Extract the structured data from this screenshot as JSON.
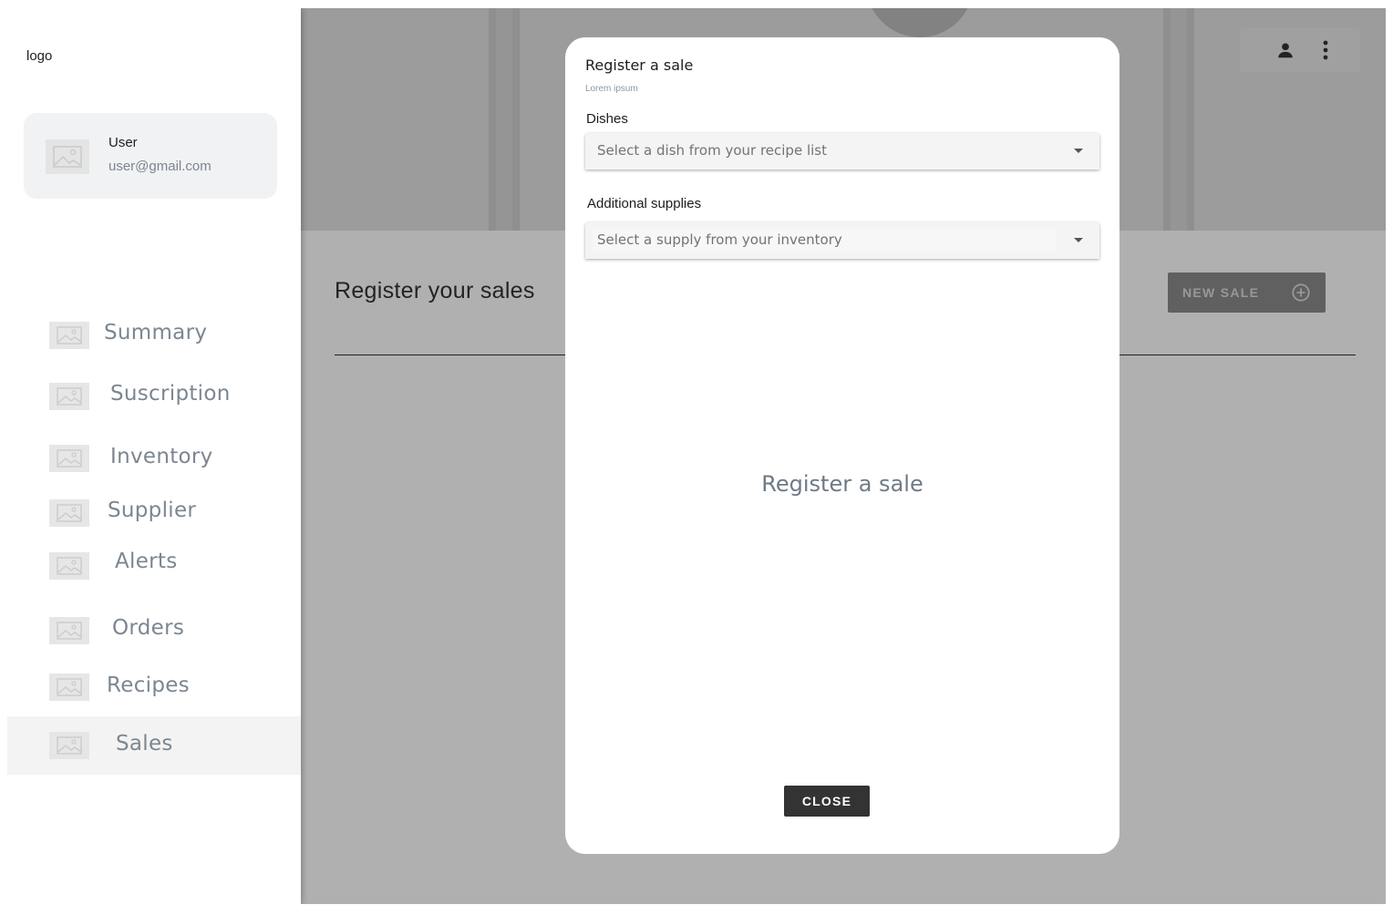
{
  "sidebar": {
    "logo": "logo",
    "user": {
      "name": "User",
      "email": "user@gmail.com",
      "avatar_icon": "image-placeholder-icon"
    },
    "items": [
      {
        "label": "Summary",
        "icon": "image-placeholder-icon",
        "active": false
      },
      {
        "label": "Suscription",
        "icon": "image-placeholder-icon",
        "active": false
      },
      {
        "label": "Inventory",
        "icon": "image-placeholder-icon",
        "active": false
      },
      {
        "label": "Supplier",
        "icon": "image-placeholder-icon",
        "active": false
      },
      {
        "label": "Alerts",
        "icon": "image-placeholder-icon",
        "active": false
      },
      {
        "label": "Orders",
        "icon": "image-placeholder-icon",
        "active": false
      },
      {
        "label": "Recipes",
        "icon": "image-placeholder-icon",
        "active": false
      },
      {
        "label": "Sales",
        "icon": "image-placeholder-icon",
        "active": true
      }
    ]
  },
  "header": {
    "actions": [
      "account-icon",
      "more-vert-icon"
    ]
  },
  "main": {
    "title": "Register your sales",
    "new_sale_label": "NEW SALE",
    "new_sale_icon": "add-circle-icon"
  },
  "modal": {
    "title": "Register a sale",
    "subtitle": "Lorem ipsum",
    "dishes_label": "Dishes",
    "dishes_placeholder": "Select a dish from your recipe list",
    "supplies_label": "Additional supplies",
    "supplies_placeholder": "Select a supply from your inventory",
    "empty_state": "Register a sale",
    "close_label": "CLOSE"
  },
  "colors": {
    "overlay": "#000000",
    "active_nav": "#f3f3f3",
    "nav_text": "#7c8691",
    "button_dark": "#333333",
    "new_sale_bg": "#8b8b8b"
  }
}
